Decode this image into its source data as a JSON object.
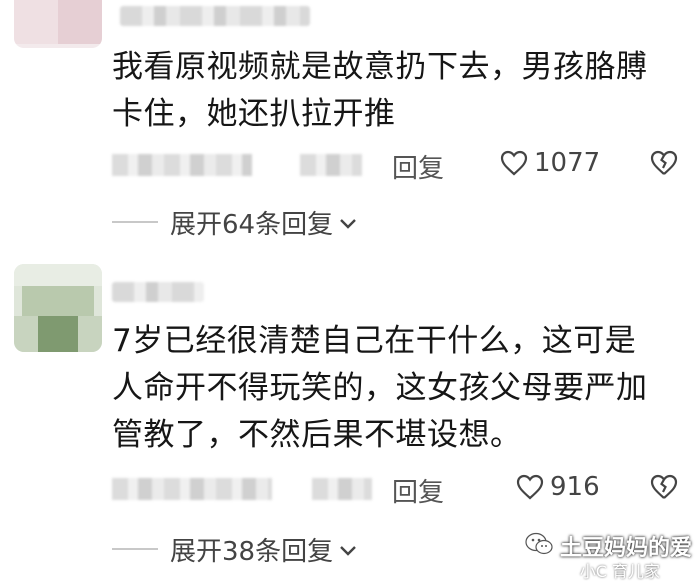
{
  "comments": [
    {
      "text": "我看原视频就是故意扔下去，男孩胳膊\n卡住，她还扒拉开推",
      "reply_label": "回复",
      "like_count": "1077",
      "expand_label": "展开64条回复"
    },
    {
      "text": "7岁已经很清楚自己在干什么，这可是\n人命开不得玩笑的，这女孩父母要严加\n管教了，不然后果不堪设想。",
      "reply_label": "回复",
      "like_count": "916",
      "expand_label": "展开38条回复"
    }
  ],
  "watermark": {
    "text": "土豆妈妈的爱",
    "subtext": "小C 育儿家"
  },
  "icons": {
    "like": "heart-outline-icon",
    "dislike": "broken-heart-icon",
    "expand": "chevron-down-icon",
    "watermark": "wechat-icon"
  },
  "colors": {
    "text": "#161616",
    "meta": "#555555",
    "divider": "#c8c8c8"
  }
}
